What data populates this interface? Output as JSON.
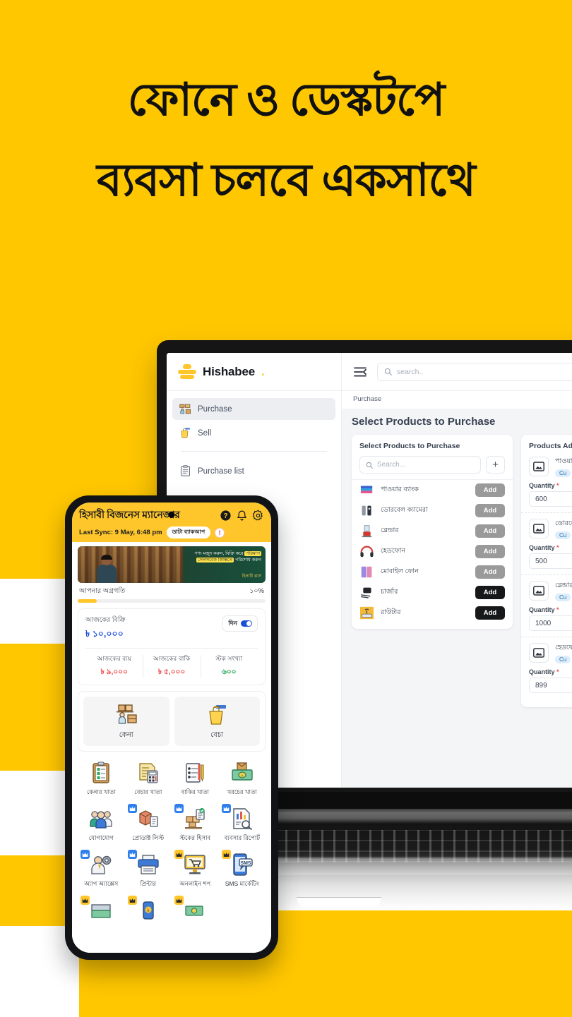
{
  "headline": {
    "line1": "ফোনে ও ডেস্কটপে",
    "line2": "ব্যবসা চলবে একসাথে"
  },
  "colors": {
    "background": "#FFC700",
    "brand_yellow": "#FFC62B",
    "accent_blue": "#1C4FD8",
    "danger_red": "#EE4A4A",
    "success_green": "#21A355",
    "dark_button": "#17181A",
    "grey_button": "#9A9A9A"
  },
  "desktop": {
    "brand": {
      "name": "Hishabee",
      "dot": "."
    },
    "sidebar": {
      "items": [
        {
          "label": "Purchase",
          "icon": "purchase-boxes-icon",
          "active": true
        },
        {
          "label": "Sell",
          "icon": "sell-bag-icon",
          "active": false
        }
      ],
      "items2": [
        {
          "label": "Purchase list",
          "icon": "clipboard-list-icon",
          "active": false
        }
      ]
    },
    "topbar": {
      "menu_icon": "hamburger-collapse-icon",
      "search_placeholder": "search.."
    },
    "breadcrumb": "Purchase",
    "page_title": "Select Products to Purchase",
    "select_panel": {
      "title": "Select Products to Purchase",
      "search_placeholder": "Search...",
      "add_new_label": "+",
      "products": [
        {
          "name": "পাওয়ার ব্যাংক",
          "action": "Add",
          "action_style": "grey"
        },
        {
          "name": "ডোরবেল ক্যামেরা",
          "action": "Add",
          "action_style": "grey"
        },
        {
          "name": "ব্লেন্ডার",
          "action": "Add",
          "action_style": "grey"
        },
        {
          "name": "হেডফোন",
          "action": "Add",
          "action_style": "grey"
        },
        {
          "name": "মোবাইল ফোন",
          "action": "Add",
          "action_style": "grey"
        },
        {
          "name": "চার্জার",
          "action": "Add",
          "action_style": "dark"
        },
        {
          "name": "রাউটার",
          "action": "Add",
          "action_style": "dark"
        }
      ]
    },
    "added_panel": {
      "title": "Products Added",
      "quantity_label": "Quantity",
      "required_mark": "*",
      "items": [
        {
          "name": "পাওয়ার ব্যাংক",
          "chip": "Cu",
          "quantity": "600"
        },
        {
          "name": "ডোরবেল ক্যামেরা",
          "chip": "Cu",
          "quantity": "500"
        },
        {
          "name": "ব্লেন্ডার",
          "chip": "Cu",
          "quantity": "1000"
        },
        {
          "name": "হেডফোন",
          "chip": "Cu",
          "quantity": "899"
        }
      ]
    }
  },
  "phone": {
    "header": {
      "title": "হিসাবী বিজনেস ম্যানেজার",
      "help_icon": "question-mark-icon",
      "bell_icon": "bell-icon",
      "gear_icon": "gear-icon",
      "sync_text": "Last Sync: 9 May, 6:48 pm",
      "backup_chip": "ডাটা ব্যাকআপ",
      "warning": "!"
    },
    "promo": {
      "line1_a": "পণ্য মজুদ করুন, বিক্রি করে ",
      "line1_hl": "পরিমাপ",
      "line2_hl": "সেলসবেক কিস্তিতে",
      "line2_b": " পরিশোধ করুন",
      "badge": "হিসাবী প্লাস"
    },
    "progress": {
      "label": "আপনার অগ্রগতি",
      "percent_label": "১০%",
      "percent": 10
    },
    "sales_card": {
      "today_label": "আজকের বিক্রি",
      "today_value": "৳ ১০,০০০",
      "toggle_label": "দিন",
      "stats": [
        {
          "label": "আজকের ব্যয়",
          "value": "৳ ৯,০০০",
          "tone": "red"
        },
        {
          "label": "আজকের বাকি",
          "value": "৳ ৫,০০০",
          "tone": "red"
        },
        {
          "label": "স্টক সংখ্যা",
          "value": "৬০০",
          "tone": "green"
        }
      ]
    },
    "actions": [
      {
        "label": "কেনা",
        "icon": "warehouse-boxes-icon"
      },
      {
        "label": "বেচা",
        "icon": "shopping-bag-card-icon"
      }
    ],
    "grid": [
      {
        "label": "কেনার খাতা",
        "icon": "clipboard-check-icon",
        "badge": "none"
      },
      {
        "label": "বেচার খাতা",
        "icon": "invoice-calculator-icon",
        "badge": "none"
      },
      {
        "label": "বাকির খাতা",
        "icon": "notebook-pen-icon",
        "badge": "none"
      },
      {
        "label": "খরচের খাতা",
        "icon": "money-box-icon",
        "badge": "none"
      },
      {
        "label": "যোগাযোগ",
        "icon": "contacts-people-icon",
        "badge": "none"
      },
      {
        "label": "প্রোডাক্ট লিস্ট",
        "icon": "product-box-list-icon",
        "badge": "blue"
      },
      {
        "label": "স্টকের হিসাব",
        "icon": "stock-check-icon",
        "badge": "blue"
      },
      {
        "label": "ব্যবসার রিপোর্ট",
        "icon": "report-chart-icon",
        "badge": "blue"
      },
      {
        "label": "অ্যাপ অ্যাক্সেস",
        "icon": "user-gear-icon",
        "badge": "blue"
      },
      {
        "label": "প্রিন্টার",
        "icon": "printer-icon",
        "badge": "blue"
      },
      {
        "label": "অনলাইন শপ",
        "icon": "online-shop-cart-icon",
        "badge": "gold"
      },
      {
        "label": "SMS মার্কেটিং",
        "icon": "sms-phone-icon",
        "badge": "gold"
      }
    ],
    "grid_partial": [
      {
        "label": "",
        "icon": "store-front-icon",
        "badge": "gold"
      },
      {
        "label": "",
        "icon": "mobile-payment-icon",
        "badge": "gold"
      },
      {
        "label": "",
        "icon": "cash-money-icon",
        "badge": "gold"
      }
    ]
  }
}
